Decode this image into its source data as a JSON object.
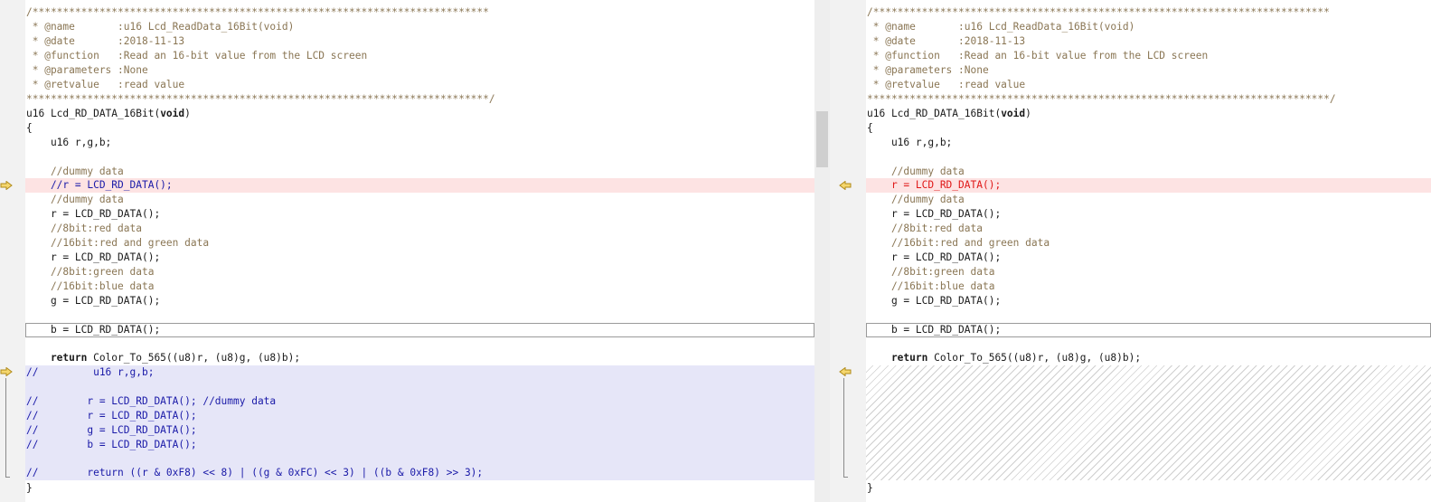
{
  "left": {
    "header": [
      "/***************************************************************************",
      " * @name       :u16 Lcd_ReadData_16Bit(void)",
      " * @date       :2018-11-13",
      " * @function   :Read an 16-bit value from the LCD screen",
      " * @parameters :None",
      " * @retvalue   :read value",
      "****************************************************************************/"
    ],
    "func_type": "u16 Lcd_RD_DATA_16Bit(",
    "func_kw": "void",
    "func_close": ")",
    "open_brace": "{",
    "decl": "    u16 r,g,b;",
    "c_dummy1": "    //dummy data",
    "c_changed": "    //r = LCD_RD_DATA();",
    "c_dummy2": "    //dummy data",
    "r1": "    r = LCD_RD_DATA();",
    "c_8red": "    //8bit:red data",
    "c_16rg": "    //16bit:red and green data",
    "r2": "    r = LCD_RD_DATA();",
    "c_8green": "    //8bit:green data",
    "c_16blue": "    //16bit:blue data",
    "g1": "    g = LCD_RD_DATA();",
    "b1": "    b = LCD_RD_DATA();",
    "ret_kw": "    return",
    "ret_rest": " Color_To_565((u8)r, (u8)g, (u8)b);",
    "blk1": "//         u16 r,g,b;",
    "blk2": "//        r = LCD_RD_DATA(); //dummy data",
    "blk3": "//        r = LCD_RD_DATA();",
    "blk4": "//        g = LCD_RD_DATA();",
    "blk5": "//        b = LCD_RD_DATA();",
    "blk6": "//        return ((r & 0xF8) << 8) | ((g & 0xFC) << 3) | ((b & 0xF8) >> 3);",
    "close_brace": "}"
  },
  "right": {
    "header": [
      "/***************************************************************************",
      " * @name       :u16 Lcd_ReadData_16Bit(void)",
      " * @date       :2018-11-13",
      " * @function   :Read an 16-bit value from the LCD screen",
      " * @parameters :None",
      " * @retvalue   :read value",
      "****************************************************************************/"
    ],
    "func_type": "u16 Lcd_RD_DATA_16Bit(",
    "func_kw": "void",
    "func_close": ")",
    "open_brace": "{",
    "decl": "    u16 r,g,b;",
    "c_dummy1": "    //dummy data",
    "changed": "    r = LCD_RD_DATA();",
    "c_dummy2": "    //dummy data",
    "r1": "    r = LCD_RD_DATA();",
    "c_8red": "    //8bit:red data",
    "c_16rg": "    //16bit:red and green data",
    "r2": "    r = LCD_RD_DATA();",
    "c_8green": "    //8bit:green data",
    "c_16blue": "    //16bit:blue data",
    "g1": "    g = LCD_RD_DATA();",
    "b1": "    b = LCD_RD_DATA();",
    "ret_kw": "    return",
    "ret_rest": " Color_To_565((u8)r, (u8)g, (u8)b);",
    "close_brace": "}"
  },
  "colors": {
    "comment": "#8a7654",
    "comment_block": "#1a1aa8",
    "changed_bg": "#fde3e3",
    "added_bg": "#e6e6f8",
    "removed_text": "#e01818",
    "arrow": "#e8c23a"
  },
  "icons": [
    "diff-arrow-right-icon",
    "diff-arrow-left-icon"
  ]
}
